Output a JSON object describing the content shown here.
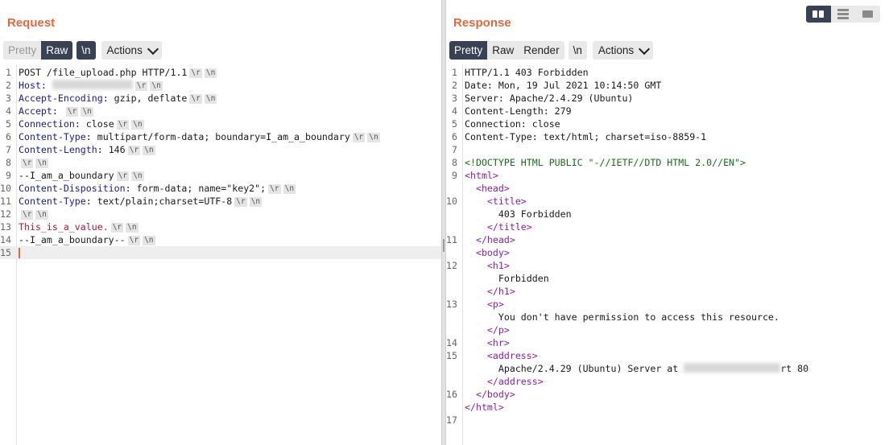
{
  "request": {
    "title": "Request",
    "toolbar": {
      "pretty": "Pretty",
      "raw": "Raw",
      "newline": "\\n",
      "actions": "Actions"
    },
    "lines": [
      {
        "n": "1",
        "parts": [
          {
            "t": "POST /file_upload.php HTTP/1.1"
          }
        ],
        "crlf": true
      },
      {
        "n": "2",
        "parts": [
          {
            "t": "Host: ",
            "c": "k-key"
          },
          {
            "blur": 100
          }
        ],
        "crlf": true
      },
      {
        "n": "3",
        "parts": [
          {
            "t": "Accept-Encoding",
            "c": "k-key"
          },
          {
            "t": ": gzip, deflate"
          }
        ],
        "crlf": true
      },
      {
        "n": "4",
        "parts": [
          {
            "t": "Accept",
            "c": "k-key"
          },
          {
            "t": ": "
          }
        ],
        "crlf": true
      },
      {
        "n": "5",
        "parts": [
          {
            "t": "Connection",
            "c": "k-key"
          },
          {
            "t": ": close"
          }
        ],
        "crlf": true
      },
      {
        "n": "6",
        "parts": [
          {
            "t": "Content-Type",
            "c": "k-key"
          },
          {
            "t": ": multipart/form-data; boundary=I_am_a_boundary"
          }
        ],
        "crlf": true
      },
      {
        "n": "7",
        "parts": [
          {
            "t": "Content-Length",
            "c": "k-key"
          },
          {
            "t": ": 146"
          }
        ],
        "crlf": true
      },
      {
        "n": "8",
        "parts": [],
        "crlf": true
      },
      {
        "n": "9",
        "parts": [
          {
            "t": "--I_am_a_boundary"
          }
        ],
        "crlf": true
      },
      {
        "n": "10",
        "parts": [
          {
            "t": "Content-Disposition",
            "c": "k-key"
          },
          {
            "t": ": form-data; name=\"key2\";"
          }
        ],
        "crlf": true
      },
      {
        "n": "11",
        "parts": [
          {
            "t": "Content-Type",
            "c": "k-key"
          },
          {
            "t": ": text/plain;charset=UTF-8"
          }
        ],
        "crlf": true
      },
      {
        "n": "12",
        "parts": [],
        "crlf": true
      },
      {
        "n": "13",
        "parts": [
          {
            "t": "This_is_a_value.",
            "c": "k-red"
          }
        ],
        "crlf": true
      },
      {
        "n": "14",
        "parts": [
          {
            "t": "--I_am_a_boundary--"
          }
        ],
        "crlf": true
      },
      {
        "n": "15",
        "parts": [],
        "crlf": false,
        "current": true
      }
    ]
  },
  "response": {
    "title": "Response",
    "toolbar": {
      "pretty": "Pretty",
      "raw": "Raw",
      "render": "Render",
      "newline": "\\n",
      "actions": "Actions"
    },
    "lines": [
      {
        "n": "1",
        "parts": [
          {
            "t": "HTTP/1.1 403 Forbidden"
          }
        ]
      },
      {
        "n": "2",
        "parts": [
          {
            "t": "Date: Mon, 19 Jul 2021 10:14:50 GMT"
          }
        ]
      },
      {
        "n": "3",
        "parts": [
          {
            "t": "Server: Apache/2.4.29 (Ubuntu)"
          }
        ]
      },
      {
        "n": "4",
        "parts": [
          {
            "t": "Content-Length: 279"
          }
        ]
      },
      {
        "n": "5",
        "parts": [
          {
            "t": "Connection: close"
          }
        ]
      },
      {
        "n": "6",
        "parts": [
          {
            "t": "Content-Type: text/html; charset=iso-8859-1"
          }
        ]
      },
      {
        "n": "7",
        "parts": []
      },
      {
        "n": "8",
        "parts": [
          {
            "t": "<!DOCTYPE HTML PUBLIC \"-//IETF//DTD HTML 2.0//EN\">",
            "c": "k-doc"
          }
        ]
      },
      {
        "n": "9",
        "parts": [
          {
            "t": "<html>",
            "c": "k-tag"
          }
        ]
      },
      {
        "n": "",
        "parts": [
          {
            "t": "  "
          },
          {
            "t": "<head>",
            "c": "k-tag"
          }
        ]
      },
      {
        "n": "10",
        "parts": [
          {
            "t": "    "
          },
          {
            "t": "<title>",
            "c": "k-tag"
          }
        ]
      },
      {
        "n": "",
        "parts": [
          {
            "t": "      403 Forbidden"
          }
        ]
      },
      {
        "n": "",
        "parts": [
          {
            "t": "    "
          },
          {
            "t": "</title>",
            "c": "k-tag"
          }
        ]
      },
      {
        "n": "11",
        "parts": [
          {
            "t": "  "
          },
          {
            "t": "</head>",
            "c": "k-tag"
          }
        ]
      },
      {
        "n": "",
        "parts": [
          {
            "t": "  "
          },
          {
            "t": "<body>",
            "c": "k-tag"
          }
        ]
      },
      {
        "n": "12",
        "parts": [
          {
            "t": "    "
          },
          {
            "t": "<h1>",
            "c": "k-tag"
          }
        ]
      },
      {
        "n": "",
        "parts": [
          {
            "t": "      Forbidden"
          }
        ]
      },
      {
        "n": "",
        "parts": [
          {
            "t": "    "
          },
          {
            "t": "</h1>",
            "c": "k-tag"
          }
        ]
      },
      {
        "n": "13",
        "parts": [
          {
            "t": "    "
          },
          {
            "t": "<p>",
            "c": "k-tag"
          }
        ]
      },
      {
        "n": "",
        "parts": [
          {
            "t": "      You don't have permission to access this resource."
          }
        ]
      },
      {
        "n": "",
        "parts": [
          {
            "t": "    "
          },
          {
            "t": "</p>",
            "c": "k-tag"
          }
        ]
      },
      {
        "n": "14",
        "parts": [
          {
            "t": "    "
          },
          {
            "t": "<hr>",
            "c": "k-tag"
          }
        ]
      },
      {
        "n": "15",
        "parts": [
          {
            "t": "    "
          },
          {
            "t": "<address>",
            "c": "k-tag"
          }
        ]
      },
      {
        "n": "",
        "parts": [
          {
            "t": "      Apache/2.4.29 (Ubuntu) Server at "
          },
          {
            "blur": 120
          },
          {
            "t": "rt 80"
          }
        ]
      },
      {
        "n": "",
        "parts": [
          {
            "t": "    "
          },
          {
            "t": "</address>",
            "c": "k-tag"
          }
        ]
      },
      {
        "n": "16",
        "parts": [
          {
            "t": "  "
          },
          {
            "t": "</body>",
            "c": "k-tag"
          }
        ]
      },
      {
        "n": "",
        "parts": [
          {
            "t": "</html>",
            "c": "k-tag"
          }
        ]
      },
      {
        "n": "17",
        "parts": []
      }
    ]
  },
  "crlf_labels": [
    "\\r",
    "\\n"
  ],
  "layout_switch": {
    "active": "split-vertical"
  },
  "colors": {
    "accent": "#e8673c",
    "active_button": "#394155",
    "header_key": "#1a1a9a",
    "html_tag": "#8f1dae",
    "doctype": "#1b6e1b",
    "value_red": "#b0183b"
  }
}
